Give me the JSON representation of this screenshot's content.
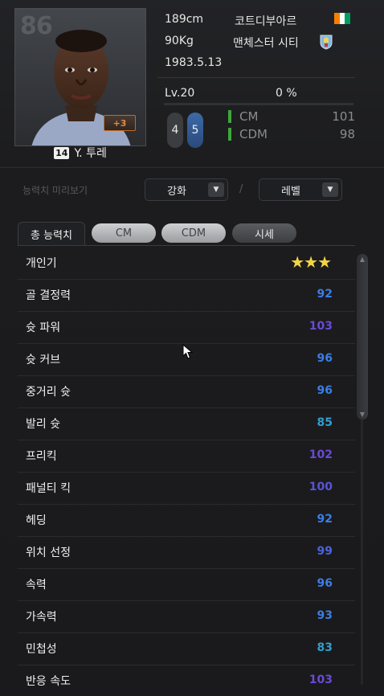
{
  "player": {
    "ovr": "86",
    "plus": "+3",
    "number": "14",
    "name": "Y. 투레",
    "height": "189cm",
    "weight": "90Kg",
    "birth": "1983.5.13",
    "nation": "코트디부아르",
    "club": "맨체스터 시티",
    "flag_colors": [
      "#f77f00",
      "#ffffff",
      "#009e60"
    ]
  },
  "level": {
    "label": "Lv.20",
    "progress_text": "0 %",
    "progress": 0
  },
  "feet": {
    "left": "4",
    "right": "5"
  },
  "positions": [
    {
      "name": "CM",
      "value": "101"
    },
    {
      "name": "CDM",
      "value": "98"
    }
  ],
  "preview": {
    "label": "능력치 미리보기",
    "enhance": "강화",
    "level": "레벨",
    "slash": "/"
  },
  "tabs": [
    {
      "label": "총 능력치",
      "style": "active"
    },
    {
      "label": "CM",
      "style": "grey"
    },
    {
      "label": "CDM",
      "style": "grey"
    },
    {
      "label": "시세",
      "style": "dark"
    }
  ],
  "stats": [
    {
      "name": "개인기",
      "value": "★★★",
      "type": "stars"
    },
    {
      "name": "골 결정력",
      "value": "92",
      "color": "#3a7ee6"
    },
    {
      "name": "슛 파워",
      "value": "103",
      "color": "#6a4ad8"
    },
    {
      "name": "슛 커브",
      "value": "96",
      "color": "#3a7ee6"
    },
    {
      "name": "중거리 슛",
      "value": "96",
      "color": "#3a7ee6"
    },
    {
      "name": "발리 슛",
      "value": "85",
      "color": "#2e9fd0"
    },
    {
      "name": "프리킥",
      "value": "102",
      "color": "#6a4ad8"
    },
    {
      "name": "패널티 킥",
      "value": "100",
      "color": "#5a52dc"
    },
    {
      "name": "헤딩",
      "value": "92",
      "color": "#3a7ee6"
    },
    {
      "name": "위치 선정",
      "value": "99",
      "color": "#4a62e0"
    },
    {
      "name": "속력",
      "value": "96",
      "color": "#3a7ee6"
    },
    {
      "name": "가속력",
      "value": "93",
      "color": "#3a7ee6"
    },
    {
      "name": "민첩성",
      "value": "83",
      "color": "#2e9fd0"
    },
    {
      "name": "반응 속도",
      "value": "103",
      "color": "#6a4ad8"
    }
  ]
}
